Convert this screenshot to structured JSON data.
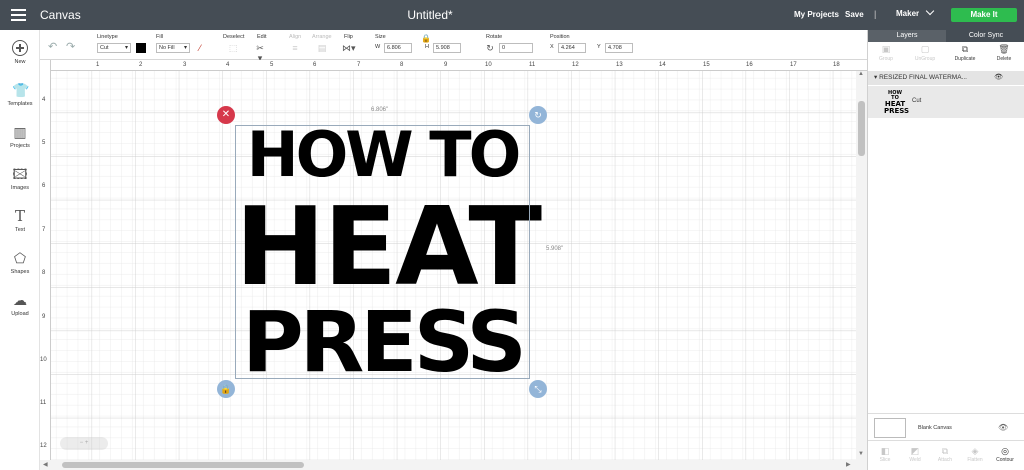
{
  "topbar": {
    "app_title": "Canvas",
    "doc_title": "Untitled*",
    "my_projects": "My Projects",
    "save": "Save",
    "separator": "|",
    "machine": "Maker",
    "make_it": "Make It"
  },
  "toolbar": {
    "linetype_label": "Linetype",
    "linetype_value": "Cut",
    "fill_label": "Fill",
    "fill_value": "No Fill",
    "deselect_label": "Deselect",
    "edit_label": "Edit",
    "align_label": "Align",
    "arrange_label": "Arrange",
    "flip_label": "Flip",
    "size_label": "Size",
    "w_label": "W",
    "w_value": "6.806",
    "h_label": "H",
    "h_value": "5.908",
    "rotate_label": "Rotate",
    "rotate_value": "0",
    "position_label": "Position",
    "x_label": "X",
    "x_value": "4.264",
    "y_label": "Y",
    "y_value": "4.708",
    "colors": {
      "linetype_swatch": "#000000",
      "fill_slash": "#c0392b"
    }
  },
  "sidebar": {
    "items": [
      {
        "label": "New",
        "icon": "plus-circle-icon"
      },
      {
        "label": "Templates",
        "icon": "shirt-icon"
      },
      {
        "label": "Projects",
        "icon": "projects-icon"
      },
      {
        "label": "Images",
        "icon": "image-icon"
      },
      {
        "label": "Text",
        "icon": "text-icon"
      },
      {
        "label": "Shapes",
        "icon": "shapes-icon"
      },
      {
        "label": "Upload",
        "icon": "cloud-upload-icon"
      }
    ]
  },
  "ruler": {
    "top": [
      "1",
      "2",
      "3",
      "4",
      "5",
      "6",
      "7",
      "8",
      "9",
      "10",
      "11",
      "12",
      "13",
      "14",
      "15",
      "16",
      "17",
      "18"
    ],
    "left": [
      "4",
      "5",
      "6",
      "7",
      "8",
      "9",
      "10",
      "11",
      "12"
    ]
  },
  "design": {
    "line1": "HOW TO",
    "line2": "HEAT",
    "line3": "PRESS",
    "width_label": "6.806\"",
    "height_label": "5.908\""
  },
  "layers_panel": {
    "tab_layers": "Layers",
    "tab_color_sync": "Color Sync",
    "actions": [
      "Group",
      "UnGroup",
      "Duplicate",
      "Delete"
    ],
    "group_name": "RESIZED FINAL WATERMA...",
    "layer_thumb": [
      "HOW TO",
      "HEAT",
      "PRESS"
    ],
    "layer_name": "Cut",
    "blank_canvas": "Blank Canvas",
    "bottom_tools": [
      "Slice",
      "Weld",
      "Attach",
      "Flatten",
      "Contour"
    ]
  },
  "canvas_colors": {
    "topbar_bg": "#454d55",
    "accent_green": "#2ebc4f",
    "close_handle": "#d6384b",
    "handle_blue": "#93b5d8"
  }
}
